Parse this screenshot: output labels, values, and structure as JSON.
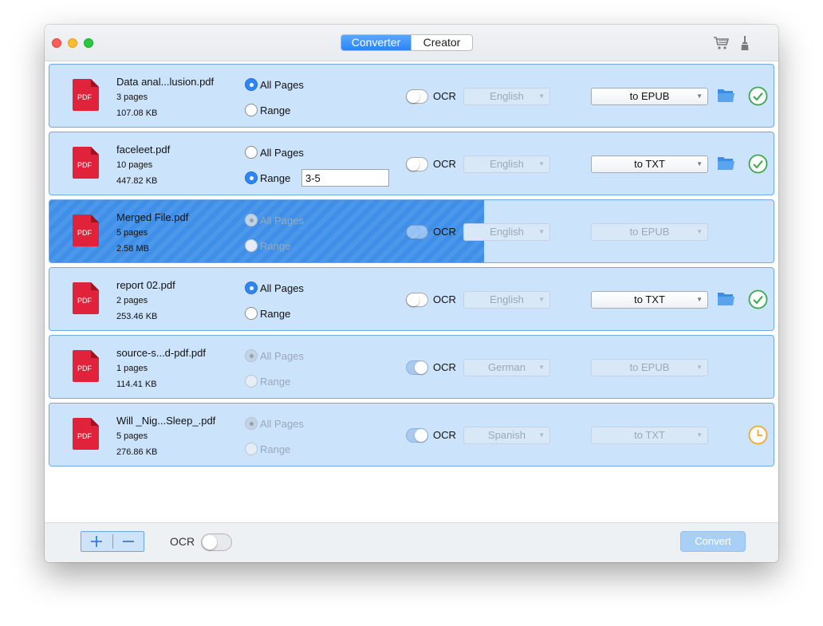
{
  "window": {
    "tabs": [
      {
        "label": "Converter",
        "active": true
      },
      {
        "label": "Creator",
        "active": false
      }
    ],
    "toolbar_icons": [
      "cart-icon",
      "brush-icon"
    ]
  },
  "common": {
    "pdf_badge": "PDF",
    "all_pages_label": "All Pages",
    "range_label": "Range",
    "ocr_label": "OCR"
  },
  "files": [
    {
      "name": "Data anal...lusion.pdf",
      "pages": "3 pages",
      "size": "107.08 KB",
      "page_mode": "all",
      "range_value": "",
      "ocr": false,
      "language": "English",
      "format": "to EPUB",
      "state": "done",
      "progress": null
    },
    {
      "name": "faceleet.pdf",
      "pages": "10 pages",
      "size": "447.82 KB",
      "page_mode": "range",
      "range_value": "3-5",
      "ocr": false,
      "language": "English",
      "format": "to TXT",
      "state": "done",
      "progress": null
    },
    {
      "name": "Merged File.pdf",
      "pages": "5 pages",
      "size": "2.58 MB",
      "page_mode": "all",
      "range_value": "",
      "ocr": false,
      "language": "English",
      "format": "to EPUB",
      "state": "converting",
      "progress": 0.6
    },
    {
      "name": "report 02.pdf",
      "pages": "2 pages",
      "size": "253.46 KB",
      "page_mode": "all",
      "range_value": "",
      "ocr": false,
      "language": "English",
      "format": "to TXT",
      "state": "done",
      "progress": null
    },
    {
      "name": "source-s...d-pdf.pdf",
      "pages": "1 pages",
      "size": "114.41 KB",
      "page_mode": "all",
      "range_value": "",
      "ocr": true,
      "language": "German",
      "format": "to EPUB",
      "state": "queued",
      "progress": null
    },
    {
      "name": "Will _Nig...Sleep_.pdf",
      "pages": "5 pages",
      "size": "276.86 KB",
      "page_mode": "all",
      "range_value": "",
      "ocr": true,
      "language": "Spanish",
      "format": "to TXT",
      "state": "waiting",
      "progress": null
    }
  ],
  "footer": {
    "ocr_label": "OCR",
    "ocr_enabled": false,
    "convert_label": "Convert"
  },
  "colors": {
    "accent": "#2f86f2",
    "row_bg": "#cbe3fb",
    "done_green": "#39a84a",
    "pending_orange": "#f5a623",
    "pdf_red": "#e0223a"
  }
}
